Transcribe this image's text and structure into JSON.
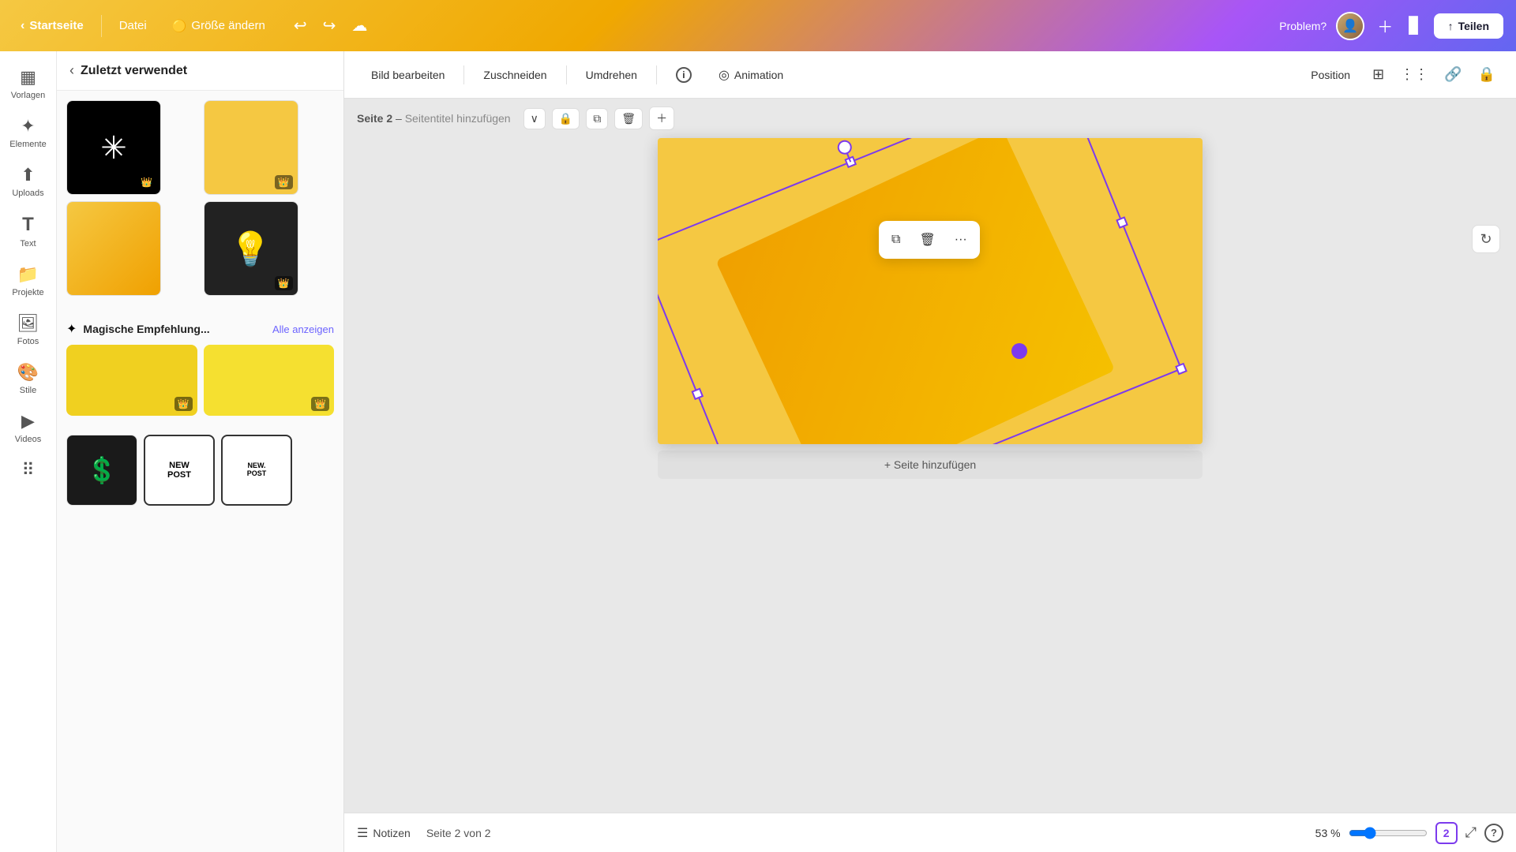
{
  "header": {
    "home_label": "Startseite",
    "datei_label": "Datei",
    "size_label": "Größe ändern",
    "problem_label": "Problem?",
    "share_label": "Teilen",
    "share_icon": "↑"
  },
  "toolbar": {
    "bild_bearbeiten": "Bild bearbeiten",
    "zuschneiden": "Zuschneiden",
    "umdrehen": "Umdrehen",
    "animation": "Animation",
    "position": "Position"
  },
  "sidebar": {
    "items": [
      {
        "id": "vorlagen",
        "label": "Vorlagen",
        "icon": "▦"
      },
      {
        "id": "elemente",
        "label": "Elemente",
        "icon": "✦"
      },
      {
        "id": "uploads",
        "label": "Uploads",
        "icon": "⬆"
      },
      {
        "id": "text",
        "label": "Text",
        "icon": "T"
      },
      {
        "id": "projekte",
        "label": "Projekte",
        "icon": "📁"
      },
      {
        "id": "fotos",
        "label": "Fotos",
        "icon": "🖼"
      },
      {
        "id": "stile",
        "label": "Stile",
        "icon": "🎨"
      },
      {
        "id": "videos",
        "label": "Videos",
        "icon": "▶"
      }
    ]
  },
  "panel": {
    "title": "Zuletzt verwendet",
    "magic_title": "Magische Empfehlung...",
    "see_all_label": "Alle anzeigen",
    "templates": [
      {
        "id": "t1",
        "type": "burst",
        "has_crown": true
      },
      {
        "id": "t2",
        "type": "yellow",
        "has_crown": true
      },
      {
        "id": "t3",
        "type": "orange-grad",
        "has_crown": false
      },
      {
        "id": "t4",
        "type": "bulb",
        "has_crown": true
      }
    ],
    "magic_items": [
      {
        "id": "m1",
        "type": "yellow-light",
        "has_crown": true
      },
      {
        "id": "m2",
        "type": "yellow-bright",
        "has_crown": true
      }
    ],
    "stickers": [
      {
        "id": "s1",
        "type": "dollar"
      },
      {
        "id": "s2",
        "type": "new-post-1"
      },
      {
        "id": "s3",
        "type": "new-post-2"
      }
    ]
  },
  "canvas": {
    "page_label": "Seite 2",
    "page_subtitle": "Seitentitel hinzufügen",
    "add_page_label": "+ Seite hinzufügen",
    "context_menu": {
      "copy_icon": "⧉",
      "delete_icon": "🗑",
      "more_icon": "···"
    }
  },
  "footer": {
    "notes_label": "Notizen",
    "page_info": "Seite 2 von 2",
    "zoom_label": "53 %",
    "zoom_value": 53,
    "page_num": "2",
    "help_label": "?"
  }
}
